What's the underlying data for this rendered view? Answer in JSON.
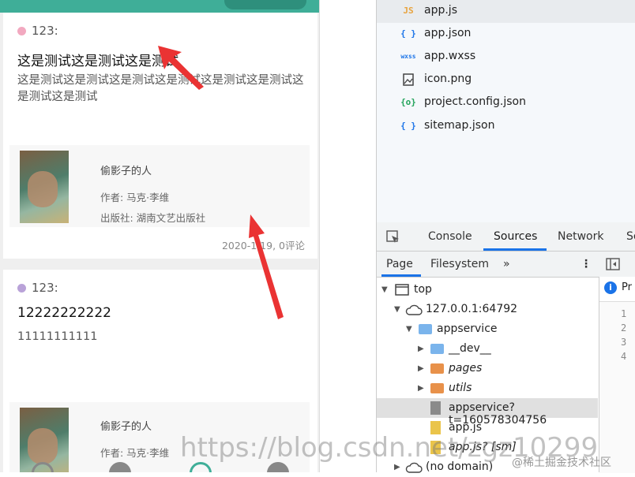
{
  "files": [
    {
      "icon": "JS",
      "icon_color": "#e8a33d",
      "name": "app.js",
      "selected": true
    },
    {
      "icon": "{ }",
      "icon_color": "#1a73e8",
      "name": "app.json"
    },
    {
      "icon": "wxss",
      "icon_color": "#1a73e8",
      "name": "app.wxss"
    },
    {
      "icon": "img",
      "icon_color": "#444",
      "name": "icon.png"
    },
    {
      "icon": "{o}",
      "icon_color": "#22a35a",
      "name": "project.config.json"
    },
    {
      "icon": "{ }",
      "icon_color": "#1a73e8",
      "name": "sitemap.json"
    }
  ],
  "devtools": {
    "tabs": [
      "Console",
      "Sources",
      "Network",
      "Se"
    ],
    "active_tab": "Sources",
    "sub_tabs": [
      "Page",
      "Filesystem",
      "»"
    ],
    "tree": {
      "top": "top",
      "host": "127.0.0.1:64792",
      "appservice": "appservice",
      "dev": "__dev__",
      "pages": "pages",
      "utils": "utils",
      "appservice_file": "appservice?t=160578304756",
      "appjs": "app.js",
      "appjs_sm": "app.js? [sm]",
      "nodomain": "(no domain)"
    },
    "right_pane": {
      "pr": "Pr",
      "lines": [
        "1",
        "2",
        "3",
        "4"
      ]
    }
  },
  "feed": [
    {
      "dot_color": "#f2a9c0",
      "user": "123:",
      "title": "这是测试这是测试这是测试",
      "body": "这是测试这是测试这是测试这是测试这是测试这是测试这是测试这是测试",
      "book_title": "偷影子的人",
      "author": "作者: 马克·李维",
      "publisher": "出版社: 湖南文艺出版社",
      "meta": "2020-1 19, 0评论"
    },
    {
      "dot_color": "#b9a2d8",
      "user": "123:",
      "title": "12222222222",
      "body": "11111111111",
      "book_title": "偷影子的人",
      "author": "作者: 马克·李维"
    }
  ],
  "watermark": "https://blog.csdn.net/zgz10299",
  "watermark_cn": "@稀土掘金技术社区"
}
